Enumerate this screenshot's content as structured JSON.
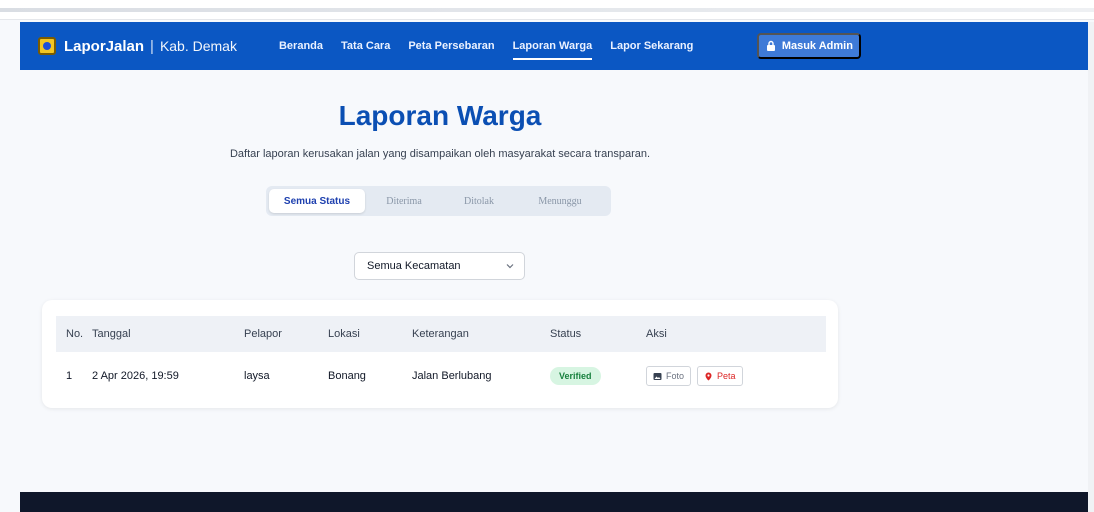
{
  "brand": {
    "name": "LaporJalan",
    "separator": "|",
    "subtitle": "Kab. Demak"
  },
  "nav": {
    "items": [
      {
        "label": "Beranda"
      },
      {
        "label": "Tata Cara"
      },
      {
        "label": "Peta Persebaran"
      },
      {
        "label": "Laporan Warga",
        "active": true
      },
      {
        "label": "Lapor Sekarang"
      }
    ],
    "admin_label": "Masuk Admin"
  },
  "page": {
    "title": "Laporan Warga",
    "description": "Daftar laporan kerusakan jalan yang disampaikan oleh masyarakat secara transparan."
  },
  "tabs": [
    {
      "label": "Semua Status",
      "active": true
    },
    {
      "label": "Diterima"
    },
    {
      "label": "Ditolak"
    },
    {
      "label": "Menunggu"
    }
  ],
  "filter": {
    "selected": "Semua Kecamatan"
  },
  "table": {
    "headers": [
      "No.",
      "Tanggal",
      "Pelapor",
      "Lokasi",
      "Keterangan",
      "Status",
      "Aksi"
    ],
    "rows": [
      {
        "no": "1",
        "date": "2 Apr 2026, 19:59",
        "reporter": "laysa",
        "location": "Bonang",
        "description": "Jalan Berlubang",
        "status": "Verified",
        "photo_label": "Foto",
        "map_label": "Peta"
      }
    ]
  },
  "colors": {
    "primary": "#0b57c3",
    "title": "#0b4fb3",
    "status_verified_bg": "#d7f5e2",
    "status_verified_text": "#17803d",
    "map_red": "#dc2626",
    "footer": "#0f172a"
  },
  "icons": {
    "brand": "shield-logo-icon",
    "admin": "lock-icon",
    "select": "chevron-down-icon",
    "photo": "image-icon",
    "map": "map-pin-icon"
  }
}
